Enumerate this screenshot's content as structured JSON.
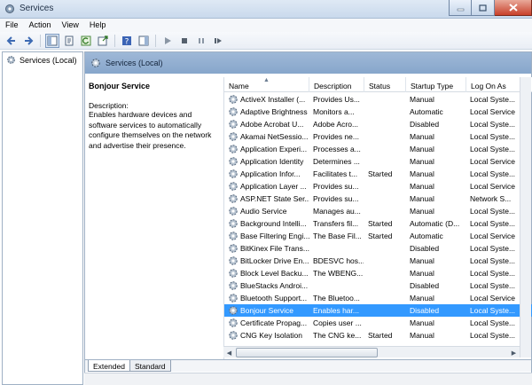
{
  "window": {
    "title": "Services"
  },
  "menu": [
    {
      "label": "File"
    },
    {
      "label": "Action"
    },
    {
      "label": "View"
    },
    {
      "label": "Help"
    }
  ],
  "tree": {
    "root_label": "Services (Local)"
  },
  "pane": {
    "header_title": "Services (Local)",
    "selected_service_title": "Bonjour Service",
    "description_label": "Description:",
    "description_text": "Enables hardware devices and software services to automatically configure themselves on the network and advertise their presence."
  },
  "columns": {
    "name": "Name",
    "description": "Description",
    "status": "Status",
    "startup_type": "Startup Type",
    "log_on_as": "Log On As"
  },
  "services": [
    {
      "name": "ActiveX Installer (...",
      "description": "Provides Us...",
      "status": "",
      "startup": "Manual",
      "logon": "Local Syste..."
    },
    {
      "name": "Adaptive Brightness",
      "description": "Monitors a...",
      "status": "",
      "startup": "Automatic",
      "logon": "Local Service"
    },
    {
      "name": "Adobe Acrobat U...",
      "description": "Adobe Acro...",
      "status": "",
      "startup": "Disabled",
      "logon": "Local Syste..."
    },
    {
      "name": "Akamai NetSessio...",
      "description": "Provides ne...",
      "status": "",
      "startup": "Manual",
      "logon": "Local Syste..."
    },
    {
      "name": "Application Experi...",
      "description": "Processes a...",
      "status": "",
      "startup": "Manual",
      "logon": "Local Syste..."
    },
    {
      "name": "Application Identity",
      "description": "Determines ...",
      "status": "",
      "startup": "Manual",
      "logon": "Local Service"
    },
    {
      "name": "Application Infor...",
      "description": "Facilitates t...",
      "status": "Started",
      "startup": "Manual",
      "logon": "Local Syste..."
    },
    {
      "name": "Application Layer ...",
      "description": "Provides su...",
      "status": "",
      "startup": "Manual",
      "logon": "Local Service"
    },
    {
      "name": "ASP.NET State Ser...",
      "description": "Provides su...",
      "status": "",
      "startup": "Manual",
      "logon": "Network S..."
    },
    {
      "name": "Audio Service",
      "description": "Manages au...",
      "status": "",
      "startup": "Manual",
      "logon": "Local Syste..."
    },
    {
      "name": "Background Intelli...",
      "description": "Transfers fil...",
      "status": "Started",
      "startup": "Automatic (D...",
      "logon": "Local Syste..."
    },
    {
      "name": "Base Filtering Engi...",
      "description": "The Base Fil...",
      "status": "Started",
      "startup": "Automatic",
      "logon": "Local Service"
    },
    {
      "name": "BitKinex File Trans...",
      "description": "",
      "status": "",
      "startup": "Disabled",
      "logon": "Local Syste..."
    },
    {
      "name": "BitLocker Drive En...",
      "description": "BDESVC hos...",
      "status": "",
      "startup": "Manual",
      "logon": "Local Syste..."
    },
    {
      "name": "Block Level Backu...",
      "description": "The WBENG...",
      "status": "",
      "startup": "Manual",
      "logon": "Local Syste..."
    },
    {
      "name": "BlueStacks Androi...",
      "description": "",
      "status": "",
      "startup": "Disabled",
      "logon": "Local Syste..."
    },
    {
      "name": "Bluetooth Support...",
      "description": "The Bluetoo...",
      "status": "",
      "startup": "Manual",
      "logon": "Local Service"
    },
    {
      "name": "Bonjour Service",
      "description": "Enables har...",
      "status": "",
      "startup": "Disabled",
      "logon": "Local Syste...",
      "selected": true
    },
    {
      "name": "Certificate Propag...",
      "description": "Copies user ...",
      "status": "",
      "startup": "Manual",
      "logon": "Local Syste..."
    },
    {
      "name": "CNG Key Isolation",
      "description": "The CNG ke...",
      "status": "Started",
      "startup": "Manual",
      "logon": "Local Syste..."
    }
  ],
  "tabs": [
    {
      "label": "Extended",
      "active": true
    },
    {
      "label": "Standard",
      "active": false
    }
  ],
  "colors": {
    "selection": "#3399ff",
    "pane_header": "#9eb8d7"
  },
  "icons": [
    "services-app-icon",
    "back-icon",
    "forward-icon",
    "console-tree-icon",
    "properties-icon",
    "refresh-icon",
    "export-icon",
    "help-icon",
    "play-icon",
    "stop-icon",
    "pause-icon",
    "restart-icon",
    "gear-icon"
  ]
}
